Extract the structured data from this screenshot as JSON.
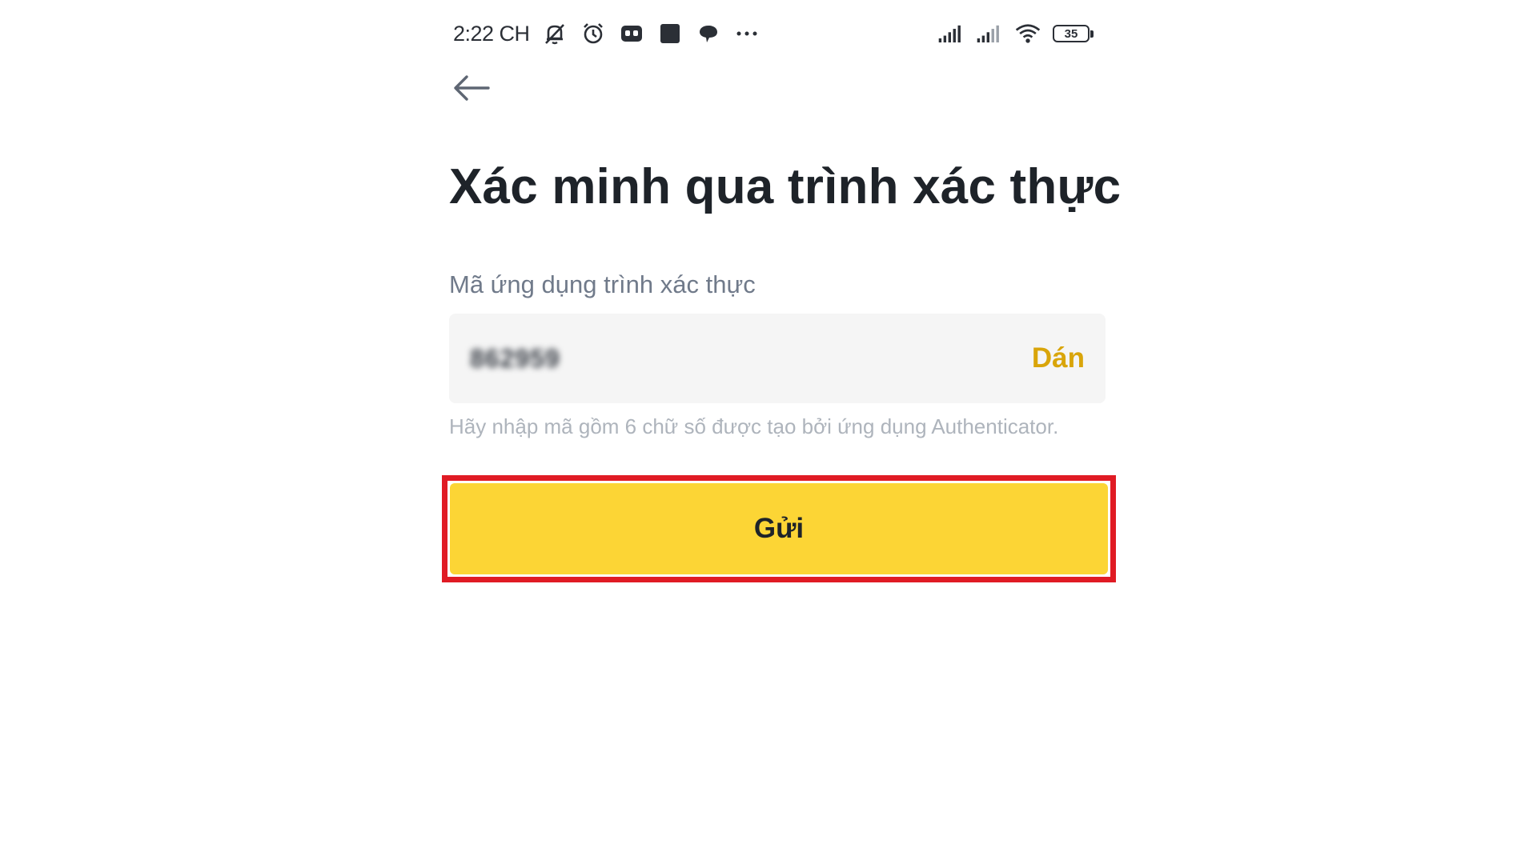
{
  "status_bar": {
    "time": "2:22 CH",
    "icons": [
      "mute-icon",
      "alarm-icon",
      "app-icon",
      "square-app-icon",
      "chat-icon",
      "more-icon",
      "signal-icon",
      "signal-icon-2",
      "wifi-icon"
    ],
    "battery_level": "35"
  },
  "header": {
    "back_icon": "arrow-left-icon"
  },
  "page": {
    "title": "Xác minh qua trình xác thực",
    "field_label": "Mã ứng dụng trình xác thực",
    "input_value": "862959",
    "paste_label": "Dán",
    "hint": "Hãy nhập mã gồm 6 chữ số được tạo bởi ứng dụng Authenticator.",
    "submit_label": "Gửi"
  },
  "colors": {
    "accent": "#fcd535",
    "paste": "#d9a50a",
    "highlight": "#e01b24",
    "title": "#1e2329",
    "label": "#707a8a",
    "hint": "#aeb4bc",
    "input_bg": "#f5f5f5"
  }
}
